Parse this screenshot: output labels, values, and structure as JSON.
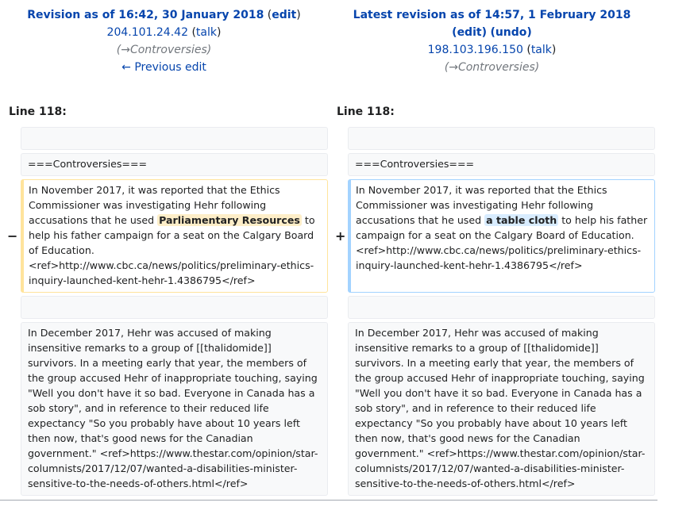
{
  "left_header": {
    "title": "Revision as of 16:42, 30 January 2018",
    "edit_link": "edit",
    "user_ip": "204.101.24.42",
    "talk": "talk",
    "summary": "Controversies",
    "prev_link": "← Previous edit"
  },
  "right_header": {
    "title": "Latest revision as of 14:57, 1 February 2018",
    "edit_link": "edit",
    "undo_link": "undo",
    "user_ip": "198.103.196.150",
    "talk": "talk",
    "summary": "Controversies"
  },
  "line_left": "Line 118:",
  "line_right": "Line 118:",
  "section_heading": "===Controversies===",
  "changed_para": {
    "left_before": "In November 2017, it was reported that the Ethics Commissioner was investigating Hehr following accusations that he used ",
    "left_hl": "Parliamentary Resources",
    "left_after": " to help his father campaign for a seat on the Calgary Board of Education. <ref>http://www.cbc.ca/news/politics/preliminary-ethics-inquiry-launched-kent-hehr-1.4386795</ref>",
    "right_before": "In November 2017, it was reported that the Ethics Commissioner was investigating Hehr following accusations that he used ",
    "right_hl": "a table cloth",
    "right_after": " to help his father campaign for a seat on the Calgary Board of Education. <ref>http://www.cbc.ca/news/politics/preliminary-ethics-inquiry-launched-kent-hehr-1.4386795</ref>"
  },
  "marker_minus": "−",
  "marker_plus": "+",
  "context_para": "In December 2017, Hehr was accused of making insensitive remarks to a group of [[thalidomide]] survivors. In a meeting early that year, the members of the group accused Hehr of inappropriate touching, saying \"Well you don't have it so bad. Everyone in Canada has a sob story\", and in reference to their reduced life expectancy \"So you probably have about 10 years left then now, that's good news for the Canadian government.\" <ref>https://www.thestar.com/opinion/star-columnists/2017/12/07/wanted-a-disabilities-minister-sensitive-to-the-needs-of-others.html</ref>"
}
